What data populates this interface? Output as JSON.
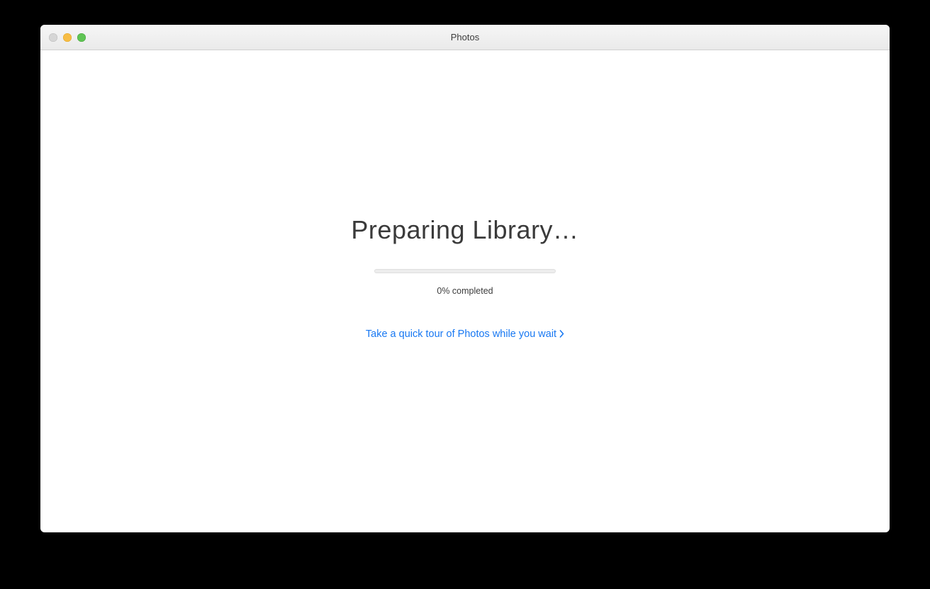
{
  "window": {
    "title": "Photos"
  },
  "main": {
    "heading": "Preparing Library…",
    "progress_percent": 0,
    "progress_label": "0% completed",
    "tour_link_label": "Take a quick tour of Photos while you wait"
  },
  "colors": {
    "link": "#1878f2"
  }
}
